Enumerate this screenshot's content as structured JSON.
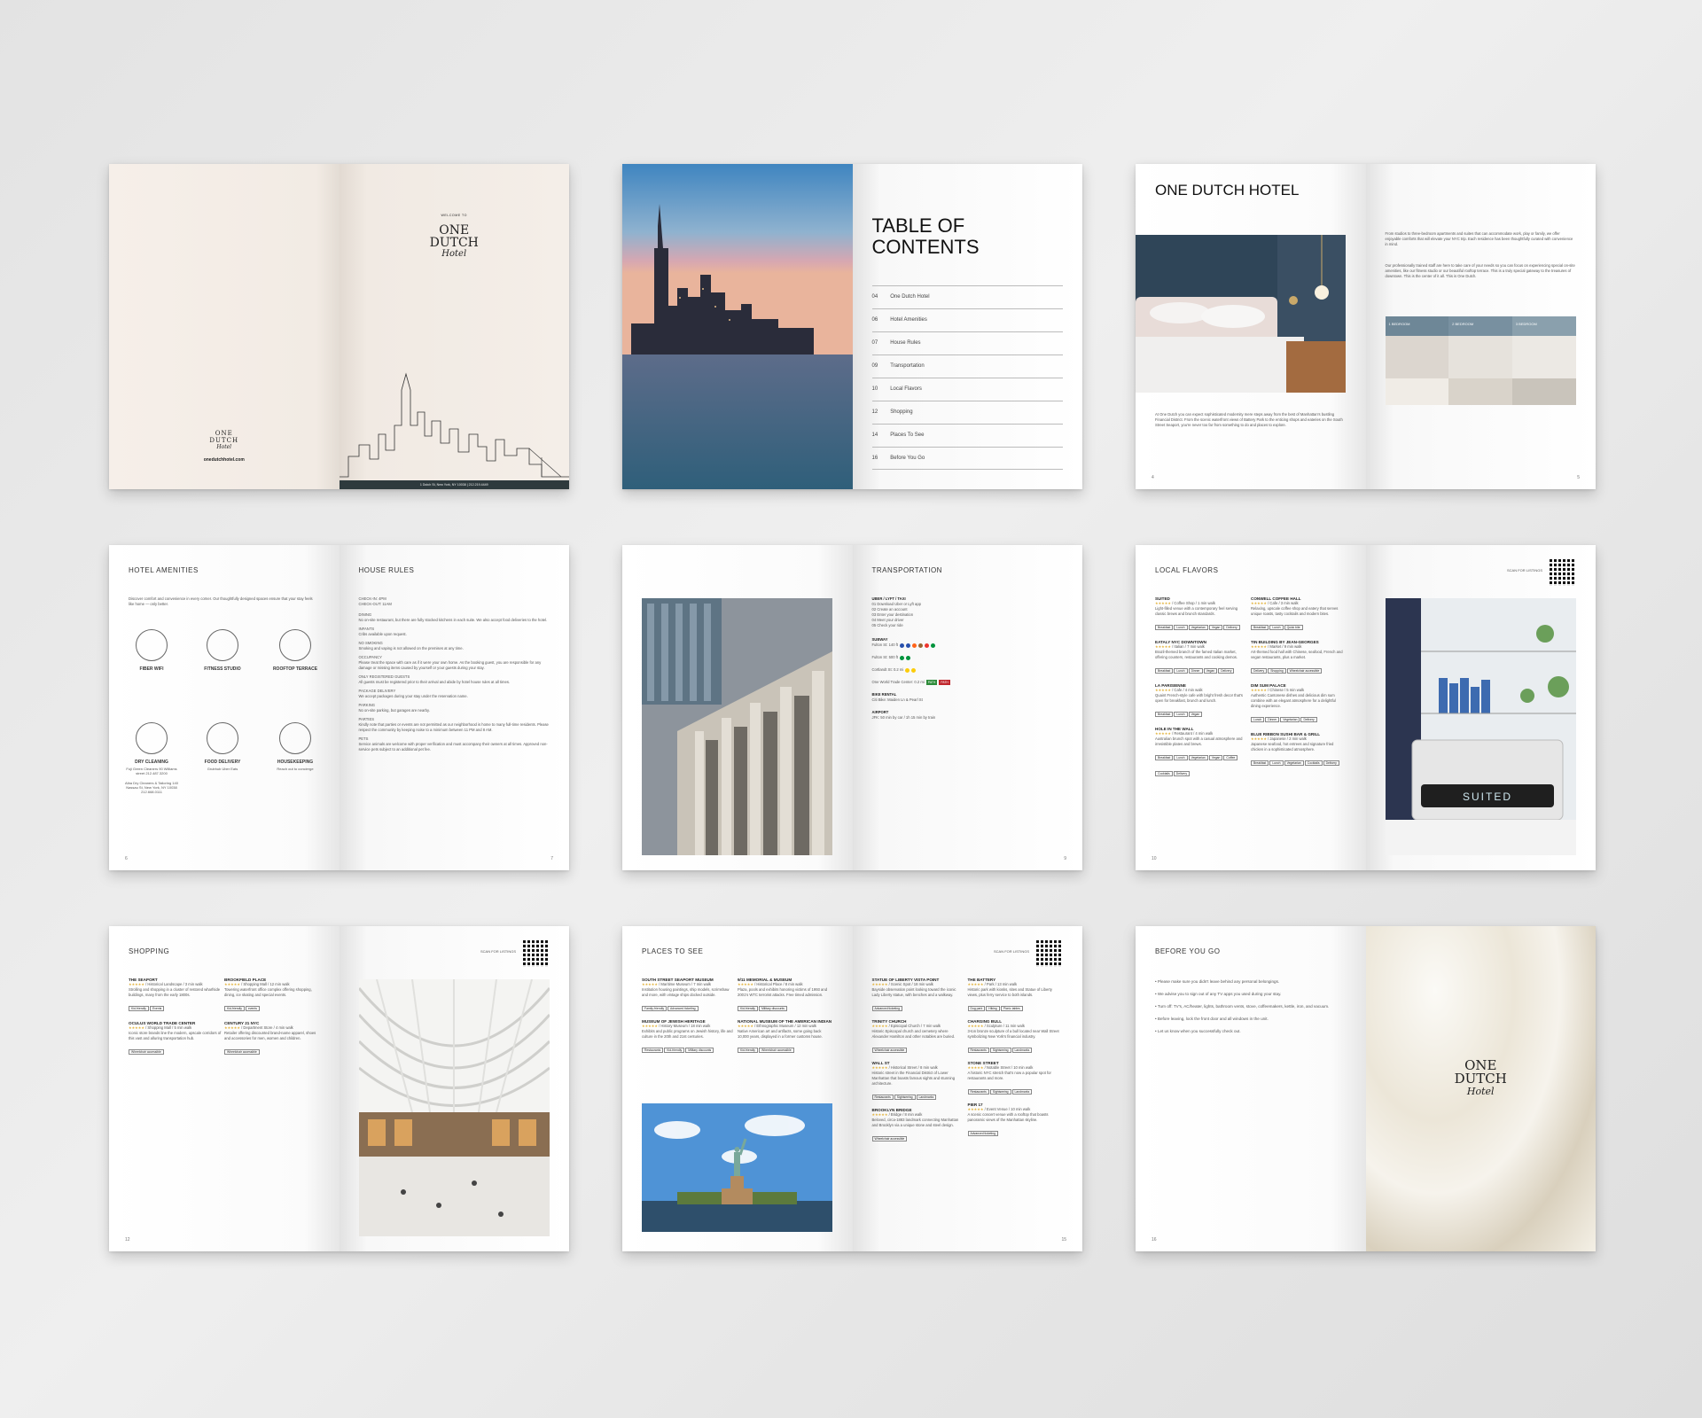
{
  "brand": {
    "line1": "ONE",
    "line2": "DUTCH",
    "script": "Hotel"
  },
  "cover": {
    "welcome": "WELCOME TO",
    "website": "onedutchhotel.com",
    "footer": "1 Dutch St, New York, NY 10038  |  212.219.4449"
  },
  "toc": {
    "title_line1": "TABLE OF",
    "title_line2": "CONTENTS",
    "items": [
      {
        "num": "04",
        "label": "One Dutch Hotel"
      },
      {
        "num": "06",
        "label": "Hotel Amenities"
      },
      {
        "num": "07",
        "label": "House Rules"
      },
      {
        "num": "09",
        "label": "Transportation"
      },
      {
        "num": "10",
        "label": "Local Flavors"
      },
      {
        "num": "12",
        "label": "Shopping"
      },
      {
        "num": "14",
        "label": "Places To See"
      },
      {
        "num": "16",
        "label": "Before You Go"
      }
    ]
  },
  "hotel": {
    "title": "ONE DUTCH HOTEL",
    "body": "At One Dutch you can expect sophisticated modernity mere steps away from the best of Manhattan's bustling Financial District. From the scenic waterfront views of Battery Park to the enticing shops and eateries on the South Street Seaport, you're never too far from something to do and places to explore.",
    "right_p1": "From studios to three-bedroom apartments and suites that can accommodate work, play or family, we offer enjoyable comforts that will elevate your NYC trip. Each residence has been thoughtfully curated with convenience in mind.",
    "right_p2": "Our professionally trained staff are here to take care of your needs so you can focus on experiencing special on-site amenities, like our fitness studio or our beautiful rooftop terrace. This is a truly special gateway to the treasures of downtown. This is the center of it all. This is One Dutch.",
    "units": [
      "1 BEDROOM",
      "2 BEDROOM",
      "3 BEDROOM"
    ],
    "page_left": "4",
    "page_right": "5"
  },
  "amenities": {
    "title": "HOTEL AMENITIES",
    "intro": "Discover comfort and convenience in every corner. Our thoughtfully designed spaces ensure that your stay feels like home — only better.",
    "items": [
      {
        "label": "FIBER WIFI",
        "sub": ""
      },
      {
        "label": "FITNESS STUDIO",
        "sub": ""
      },
      {
        "label": "ROOFTOP TERRACE",
        "sub": ""
      },
      {
        "label": "DRY CLEANING",
        "sub": "Fuji Green Cleaners 90 Williams street 212.487.3200"
      },
      {
        "label": "FOOD DELIVERY",
        "sub": "Grubhub Uber Eats"
      },
      {
        "label": "HOUSEKEEPING",
        "sub": "Reach out to concierge"
      }
    ],
    "extra_sub": "Alba Dry Cleaners & Tailoring 140 Nassau St, New York, NY 10038 212.668.0111",
    "page": "6"
  },
  "rules": {
    "title": "HOUSE RULES",
    "checkin": "CHECK-IN: 4PM",
    "checkout": "CHECK-OUT: 11AM",
    "sections": [
      {
        "h": "DINING",
        "t": "No on-site restaurant, but there are fully stocked kitchens in each suite. We also accept food deliveries to the hotel."
      },
      {
        "h": "INFANTS",
        "t": "Cribs available upon request."
      },
      {
        "h": "NO SMOKING",
        "t": "Smoking and vaping is not allowed on the premises at any time."
      },
      {
        "h": "OCCUPANCY",
        "t": "Please treat the space with care as if it were your own home. As the booking guest, you are responsible for any damage or missing items caused by yourself or your guests during your stay."
      },
      {
        "h": "ONLY REGISTERED GUESTS",
        "t": "All guests must be registered prior to their arrival and abide by hotel house rules at all times."
      },
      {
        "h": "PACKAGE DELIVERY",
        "t": "We accept packages during your stay under the reservation name."
      },
      {
        "h": "PARKING",
        "t": "No on-site parking, but garages are nearby."
      },
      {
        "h": "PARTIES",
        "t": "Kindly note that parties or events are not permitted as our neighborhood is home to many full-time residents. Please respect the community by keeping noise to a minimum between 11 PM and 8 AM."
      },
      {
        "h": "PETS",
        "t": "Service animals are welcome with proper verification and must accompany their owners at all times. Approved non-service pets subject to an additional pet fee."
      }
    ],
    "page": "7"
  },
  "transport": {
    "title": "TRANSPORTATION",
    "uber_h": "UBER / LYFT / TAXI",
    "uber_steps": [
      "01 Download Uber or Lyft app",
      "02 Create an account",
      "03 Enter your destination",
      "04 Meet your driver",
      "05 Check your ride"
    ],
    "subway_h": "SUBWAY",
    "subway": [
      "Fulton St: 140 ft",
      "Fulton St: 500 ft",
      "Cortlandt St: 0.2 mi"
    ],
    "path": "One World Trade Center: 0.2 mi",
    "path_badge": "PATH",
    "bike_h": "BIKE RENTAL",
    "bike": "Citi Bike: Maiden Ln & Pearl St",
    "airport_h": "AIRPORT",
    "airport": "JFK: 50 min by car  /  1h 15 min by train",
    "page": "9"
  },
  "flavors": {
    "title": "LOCAL FLAVORS",
    "scan": "SCAN FOR LISTINGS",
    "col1": [
      {
        "name": "SUITED",
        "meta": "/ Coffee Shop / 1 min walk",
        "desc": "Light-filled venue with a contemporary feel serving classic brews and brunch standards.",
        "tags": [
          "Breakfast",
          "Lunch",
          "Vegetarian",
          "Vegan",
          "Delivery"
        ]
      },
      {
        "name": "EATALY NYC DOWNTOWN",
        "meta": "/ Italian / 7 min walk",
        "desc": "Brazil-themed branch of the famed Italian market, offering counters, restaurants and cooking demos.",
        "tags": [
          "Breakfast",
          "Lunch",
          "Dinner",
          "Vegan",
          "Delivery"
        ]
      },
      {
        "name": "LA PARISIENNE",
        "meta": "/ Cafe / 4 min walk",
        "desc": "Quaint French-style cafe with bright fresh decor that's open for breakfast, brunch and lunch.",
        "tags": [
          "Breakfast",
          "Lunch",
          "Vegan"
        ]
      },
      {
        "name": "HOLE IN THE WALL",
        "meta": "/ Restaurant / 4 min walk",
        "desc": "Australian brunch spot with a casual atmosphere and irresistible plates and brews.",
        "tags": [
          "Breakfast",
          "Lunch",
          "Vegetarian",
          "Vegan",
          "Coffee",
          "Cocktails",
          "Delivery"
        ]
      }
    ],
    "col2": [
      {
        "name": "CONWELL COFFEE HALL",
        "meta": "/ Cafe / 3 min walk",
        "desc": "Relaxing, upscale coffee shop and eatery that serves unique roasts, tasty cocktails and modern bites.",
        "tags": [
          "Breakfast",
          "Lunch",
          "Quick bite"
        ]
      },
      {
        "name": "TIN BUILDING BY JEAN-GEORGES",
        "meta": "/ Market / 9 min walk",
        "desc": "Art-themed food hall with Chinese, seafood, French and vegan restaurants, plus a market.",
        "tags": [
          "Delivery",
          "Shopping",
          "Wheelchair accessible"
        ]
      },
      {
        "name": "DIM SUM PALACE",
        "meta": "/ Chinese / 5 min walk",
        "desc": "Authentic Cantonese dishes and delicious dim sum combine with an elegant atmosphere for a delightful dining experience.",
        "tags": [
          "Lunch",
          "Dinner",
          "Vegetarian",
          "Delivery"
        ]
      },
      {
        "name": "BLUE RIBBON SUSHI BAR & GRILL",
        "meta": "/ Japanese / 2 min walk",
        "desc": "Japanese seafood, hot entrees and signature fried chicken in a sophisticated atmosphere.",
        "tags": [
          "Breakfast",
          "Lunch",
          "Vegetarian",
          "Cocktails",
          "Delivery"
        ]
      }
    ],
    "sign": "SUITED",
    "page": "10"
  },
  "shopping": {
    "title": "SHOPPING",
    "scan": "SCAN FOR LISTINGS",
    "items": [
      {
        "name": "THE SEAPORT",
        "meta": "/ Historical Landscape / 3 min walk",
        "desc": "Strolling and shopping in a cluster of restored wharfside buildings, many from the early 1800s.",
        "tags": [
          "Kid-friendly",
          "Events"
        ]
      },
      {
        "name": "BROOKFIELD PLACE",
        "meta": "/ Shopping Mall / 12 min walk",
        "desc": "Towering waterfront office complex offering shopping, dining, ice skating and special events.",
        "tags": [
          "Kid-friendly",
          "events"
        ]
      },
      {
        "name": "OCULUS WORLD TRADE CENTER",
        "meta": "/ Shopping Mall / 5 min walk",
        "desc": "Iconic store brands line the modern, upscale corridors of this vast and alluring transportation hub.",
        "tags": [
          "Wheelchair accessible"
        ]
      },
      {
        "name": "CENTURY 21 NYC",
        "meta": "/ Department Store / 4 min walk",
        "desc": "Retailer offering discounted brand-name apparel, shoes and accessories for men, women and children.",
        "tags": [
          "Wheelchair accessible"
        ]
      }
    ],
    "page": "12"
  },
  "places": {
    "title": "PLACES TO SEE",
    "scan": "SCAN FOR LISTINGS",
    "left": [
      {
        "name": "SOUTH STREET SEAPORT MUSEUM",
        "meta": "/ Maritime Museum / 7 min walk",
        "desc": "Institution housing paintings, ship models, scrimshaw and more, with vintage ships docked outside.",
        "tags": [
          "Family-friendly",
          "Advanced ticketing"
        ]
      },
      {
        "name": "9/11 MEMORIAL & MUSEUM",
        "meta": "/ Historical Place / 8 min walk",
        "desc": "Plaza, pools and exhibits honoring victims of 1993 and 2001's WTC terrorist attacks. Free timed admission.",
        "tags": [
          "Kid-friendly",
          "Military discounts"
        ]
      },
      {
        "name": "MUSEUM OF JEWISH HERITAGE",
        "meta": "/ History Museum / 18 min walk",
        "desc": "Exhibits and public programs on Jewish history, life and culture in the 20th and 21st centuries.",
        "tags": [
          "Restaurants",
          "Kid-friendly",
          "Military discounts"
        ]
      },
      {
        "name": "NATIONAL MUSEUM OF THE AMERICAN INDIAN",
        "meta": "/ Ethnographic Museum / 12 min walk",
        "desc": "Native American art and artifacts, some going back 10,000 years, displayed in a former customs house.",
        "tags": [
          "Kid-friendly",
          "Wheelchair accessible"
        ]
      }
    ],
    "right": [
      {
        "name": "STATUE OF LIBERTY VISTA POINT",
        "meta": "/ Scenic Spot / 18 min walk",
        "desc": "Bayside observation point looking toward the iconic Lady Liberty statue, with benches and a walkway.",
        "tags": [
          "Advanced ticketing"
        ]
      },
      {
        "name": "THE BATTERY",
        "meta": "/ Park / 13 min walk",
        "desc": "Historic park with kiosks, sites and Statue of Liberty views, plus ferry service to both islands.",
        "tags": [
          "Dog park",
          "Hiking",
          "Picnic tables"
        ]
      },
      {
        "name": "TRINITY CHURCH",
        "meta": "/ Episcopal Church / 7 min walk",
        "desc": "Historic Episcopal church and cemetery where Alexander Hamilton and other notables are buried.",
        "tags": [
          "Wheelchair accessible"
        ]
      },
      {
        "name": "CHARGING BULL",
        "meta": "/ Sculpture / 11 min walk",
        "desc": "3-ton bronze sculpture of a bull located near Wall Street symbolizing New York's financial industry.",
        "tags": [
          "Restaurants",
          "Sightseeing",
          "Landmarks"
        ]
      },
      {
        "name": "WALL ST",
        "meta": "/ Historical Street / 8 min walk",
        "desc": "Historic street in the Financial District of Lower Manhattan that boasts famous sights and stunning architecture.",
        "tags": [
          "Restaurants",
          "Sightseeing",
          "Landmarks"
        ]
      },
      {
        "name": "STONE STREET",
        "meta": "/ Notable Street / 10 min walk",
        "desc": "A historic NYC stretch that's now a popular spot for restaurants and more.",
        "tags": [
          "Restaurants",
          "Sightseeing",
          "Landmarks"
        ]
      },
      {
        "name": "BROOKLYN BRIDGE",
        "meta": "/ Bridge / 8 min walk",
        "desc": "Beloved, circa-1883 landmark connecting Manhattan and Brooklyn via a unique stone and steel design.",
        "tags": [
          "Wheelchair accessible"
        ]
      },
      {
        "name": "PIER 17",
        "meta": "/ Event Venue / 10 min walk",
        "desc": "A scenic concert venue with a rooftop that boasts panoramic views of the Manhattan skyline.",
        "tags": [
          "Advanced ticketing"
        ]
      }
    ],
    "page_right": "15"
  },
  "before": {
    "title": "BEFORE YOU GO",
    "bullets": [
      "Please make sure you didn't leave behind any personal belongings.",
      "We advise you to sign out of any TV apps you used during your stay.",
      "Turn off: TV's, AC/heater, lights, bathroom vents, stove, coffeemakers, kettle, iron, and vacuum.",
      "Before leaving, lock the front door and all windows in the unit.",
      "Let us know when you successfully check out."
    ],
    "page": "16"
  },
  "colors": {
    "accent_dark": "#2e3a3d",
    "path_red": "#c0272d",
    "path_green": "#2e8b3a",
    "star": "#e2b23b"
  }
}
